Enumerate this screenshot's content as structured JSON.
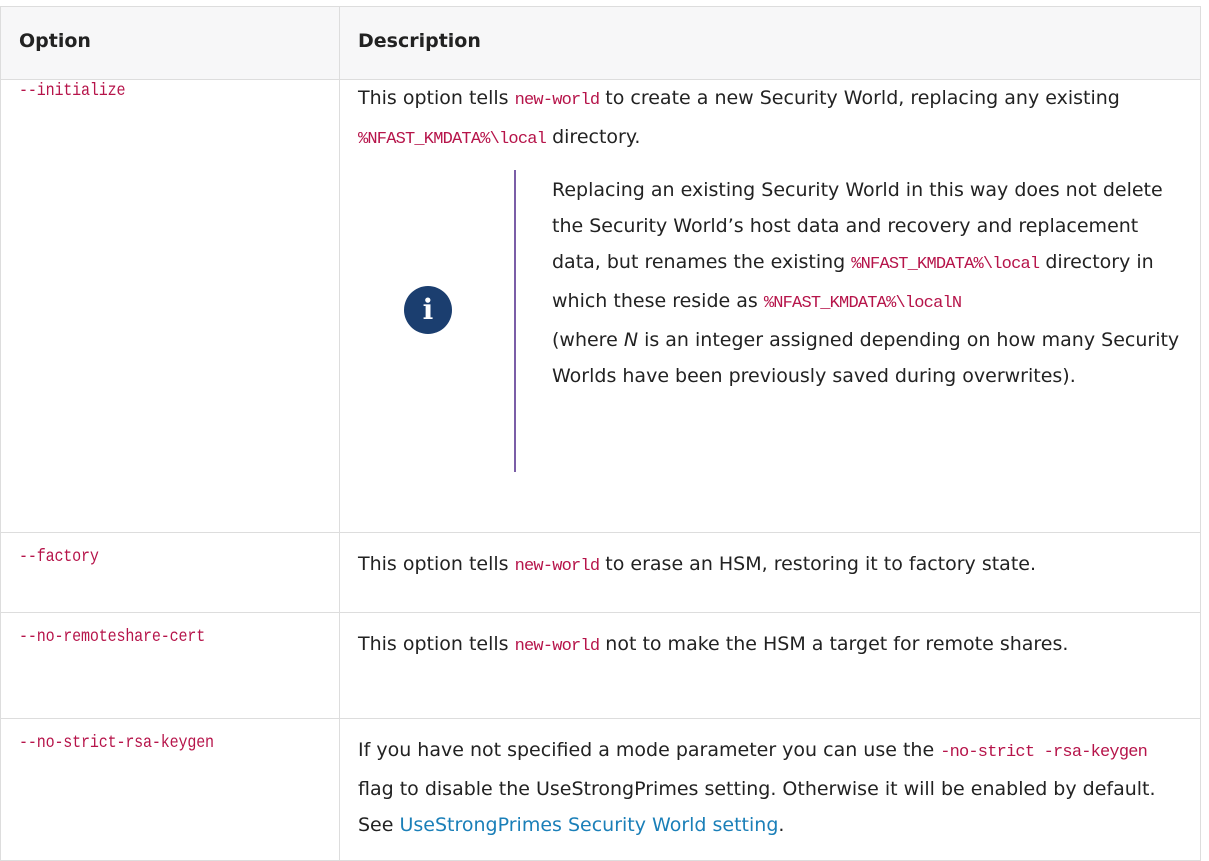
{
  "table": {
    "headers": {
      "option": "Option",
      "description": "Description"
    },
    "rows": [
      {
        "option": "--initialize",
        "desc": {
          "t1": "This option tells ",
          "c1": "new-world",
          "t2": " to create a new Security World, replacing any existing ",
          "c2": "%NFAST_KMDATA%\\local",
          "t3": " directory."
        },
        "note": {
          "icon": "info-icon",
          "icon_glyph": "i",
          "t1": "Replacing an existing Security World in this way does not delete the Security World’s host data and recovery and replacement data, but renames the existing ",
          "c1": "%NFAST_KMDATA%\\local",
          "t2": " directory in which these reside as ",
          "c2": "%NFAST_KMDATA%\\localN",
          "t3": " (where ",
          "em": "N",
          "t4": " is an integer assigned depending on how many Security Worlds have been previously saved during overwrites)."
        }
      },
      {
        "option": "--factory",
        "desc": {
          "t1": "This option tells ",
          "c1": "new-world",
          "t2": " to erase an HSM, restoring it to factory state."
        }
      },
      {
        "option": "--no-remoteshare-cert",
        "desc": {
          "t1": "This option tells ",
          "c1": "new-world",
          "t2": " not to make the HSM a target for remote shares."
        }
      },
      {
        "option": "--no-strict-rsa-keygen",
        "desc": {
          "t1": "If you have not specified a mode parameter you can use the ",
          "c1": "-no-strict -rsa-keygen",
          "t2": " flag to disable the UseStrongPrimes setting. Otherwise it will be enabled by default. See ",
          "link": "UseStrongPrimes Security World setting",
          "t3": "."
        }
      }
    ]
  },
  "colors": {
    "code": "#b6144a",
    "link": "#1a7fb8",
    "note_bar": "#7b5ea7",
    "info_icon_bg": "#1b3e6f",
    "header_bg": "#f7f7f8",
    "border": "#dddddd"
  }
}
